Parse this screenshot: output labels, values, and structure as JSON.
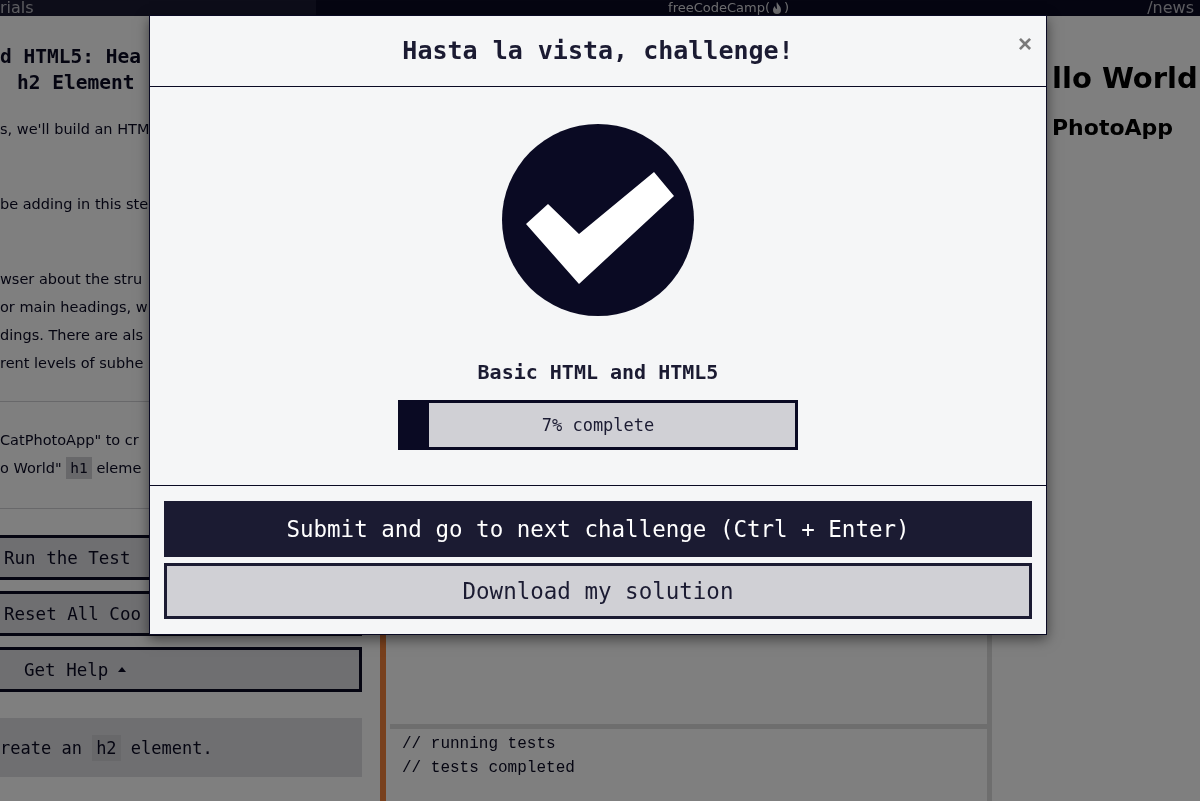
{
  "nav": {
    "left_link": "rials",
    "logo_text": "freeCodeCamp(",
    "logo_end": ")",
    "right_link": "/news"
  },
  "lesson": {
    "title_lines": [
      "d HTML5: Hea",
      "h2 Element"
    ],
    "paragraphs": [
      [
        "s, we'll build an HTM"
      ],
      [
        "be adding in this ste"
      ],
      [
        "wser about the stru",
        "or main headings, w",
        "dings. There are als",
        "rent levels of subhe"
      ]
    ],
    "instructions": [
      [
        {
          "text": "CatPhotoApp\" to cr"
        }
      ],
      [
        {
          "text": "o World\" "
        },
        {
          "code": "h1"
        },
        {
          "text": " eleme"
        }
      ]
    ],
    "buttons": [
      {
        "label": "Run the Test",
        "kind": "action"
      },
      {
        "label": "Reset All Coo",
        "kind": "action"
      },
      {
        "label": "Get Help",
        "kind": "dropdown"
      }
    ],
    "hint": [
      {
        "text": "reate an "
      },
      {
        "code": "h2"
      },
      {
        "text": " element."
      }
    ]
  },
  "console": [
    "// running tests",
    "// tests completed"
  ],
  "preview": {
    "heading": "llo World",
    "subheading": "PhotoApp"
  },
  "modal": {
    "title": "Hasta la vista, challenge!",
    "close": "×",
    "block": "Basic HTML and HTML5",
    "progress": {
      "level": 0.07,
      "text": "7% complete"
    },
    "buttons": [
      {
        "label": "Submit and go to next challenge (Ctrl + Enter)",
        "kind": "primary"
      },
      {
        "label": "Download my solution",
        "kind": "secondary"
      }
    ]
  }
}
